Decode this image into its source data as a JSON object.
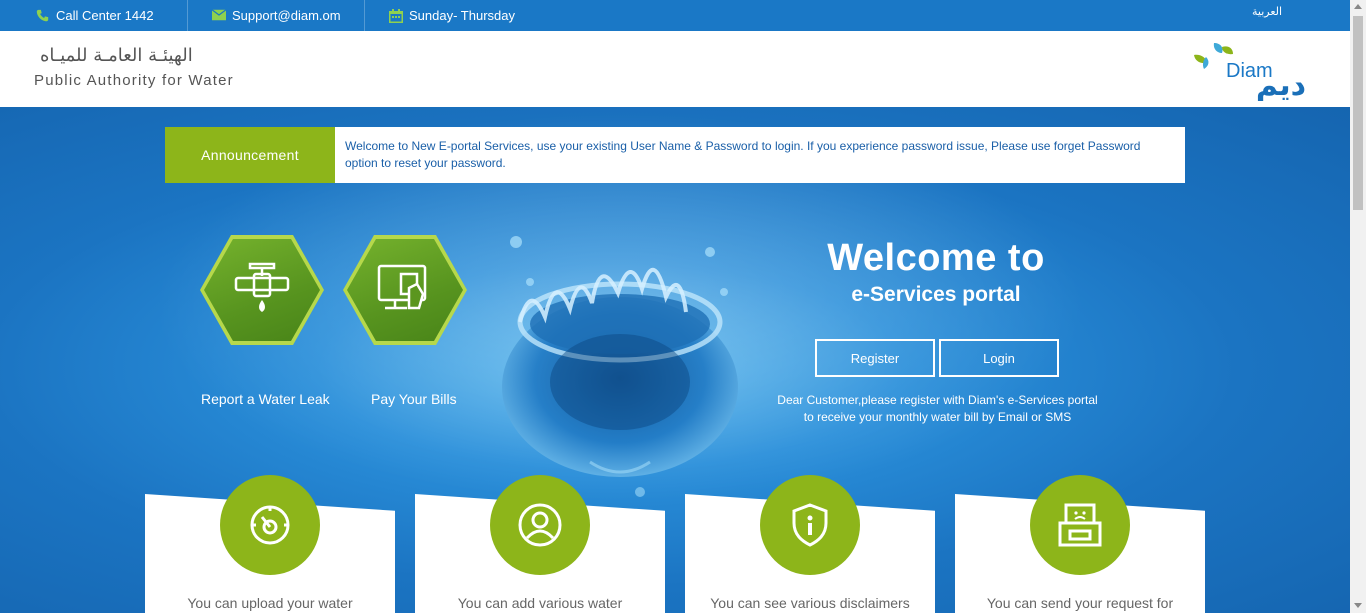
{
  "topbar": {
    "call_center": "Call Center  1442",
    "email": "Support@diam.om",
    "hours": "Sunday- Thursday",
    "language": "العربية"
  },
  "header": {
    "brand_ar": "الهيئـة العامـة للميـاه",
    "brand_en": "Public Authority for Water",
    "logo_latin": "Diam",
    "logo_ar": "ديم"
  },
  "announcement": {
    "label": "Announcement",
    "text": "Welcome to New E-portal Services, use your existing User Name & Password to login. If you experience password issue, Please use forget Password option to reset your password."
  },
  "quick_actions": [
    {
      "label": "Report a Water Leak",
      "icon": "water-leak-icon"
    },
    {
      "label": "Pay Your Bills",
      "icon": "pay-bills-icon"
    }
  ],
  "welcome": {
    "title": "Welcome to",
    "subtitle": "e-Services portal",
    "register_label": "Register",
    "login_label": "Login",
    "info_line1": "Dear Customer,please register with Diam's e-Services portal",
    "info_line2": "to receive your monthly water bill by Email or SMS"
  },
  "cards": [
    {
      "icon": "meter-icon",
      "text": "You can upload your water"
    },
    {
      "icon": "user-icon",
      "text": "You can add various water"
    },
    {
      "icon": "shield-info-icon",
      "text": "You can see various disclaimers"
    },
    {
      "icon": "complaint-box-icon",
      "text": "You can send your request for"
    }
  ],
  "colors": {
    "primary_blue": "#1a78c6",
    "accent_green": "#8db51a",
    "text_link_blue": "#1a5fa8"
  }
}
